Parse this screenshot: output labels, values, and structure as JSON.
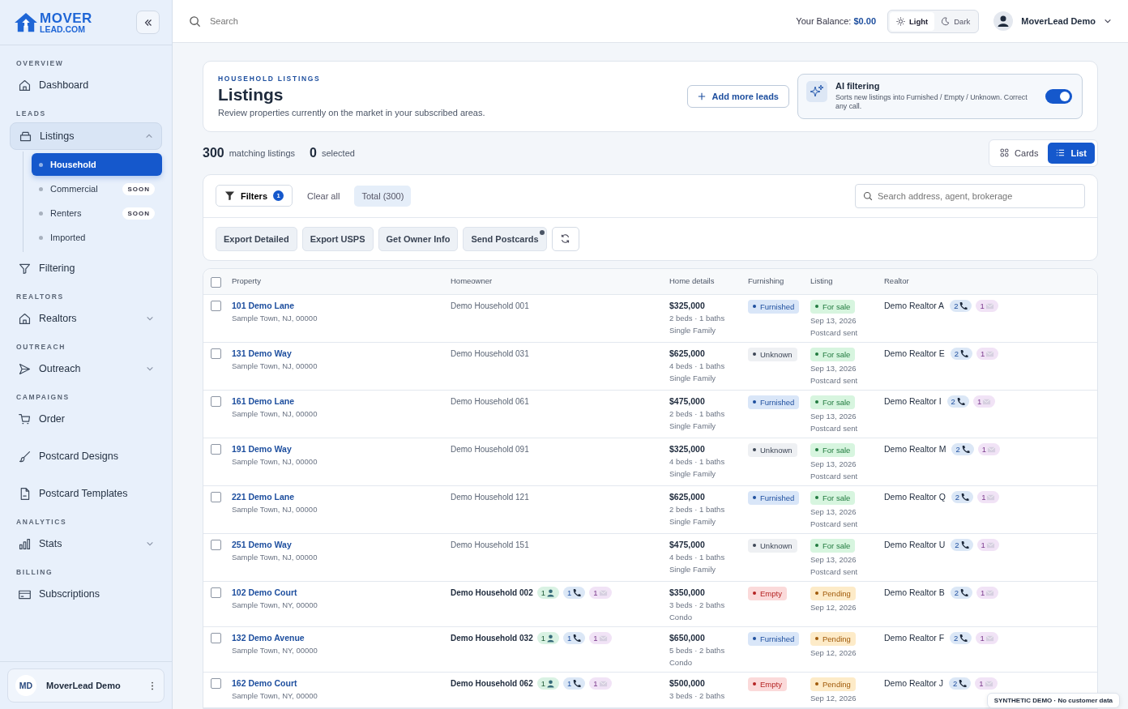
{
  "logo": {
    "line_1": "MOVER",
    "line_2": "LEAD.COM"
  },
  "sidebar": {
    "sections": [
      {
        "title": "OVERVIEW",
        "items": [
          {
            "label": "Dashboard",
            "selected": false
          }
        ]
      },
      {
        "title": "LEADS",
        "items": [
          {
            "label": "Listings",
            "selected": true,
            "expanded": true,
            "children": [
              {
                "label": "Household",
                "selected": true
              },
              {
                "label": "Commercial",
                "selected": false,
                "badge": "SOON"
              },
              {
                "label": "Renters",
                "selected": false,
                "badge": "SOON"
              },
              {
                "label": "Imported",
                "selected": false
              }
            ]
          },
          {
            "label": "Filtering",
            "selected": false
          }
        ]
      },
      {
        "title": "REALTORS",
        "items": [
          {
            "label": "Realtors",
            "selected": false,
            "expanded": false
          }
        ]
      },
      {
        "title": "OUTREACH",
        "items": [
          {
            "label": "Outreach",
            "selected": false,
            "expanded": false
          }
        ]
      },
      {
        "title": "CAMPAIGNS",
        "items": [
          {
            "label": "Order",
            "selected": false
          },
          {
            "label": "Postcard Designs",
            "selected": false
          },
          {
            "label": "Postcard Templates",
            "selected": false
          }
        ]
      },
      {
        "title": "ANALYTICS",
        "items": [
          {
            "label": "Stats",
            "selected": false,
            "expanded": false
          }
        ]
      },
      {
        "title": "BILLING",
        "items": [
          {
            "label": "Subscriptions",
            "selected": false
          }
        ]
      }
    ],
    "user": {
      "initials": "MD",
      "name": "MoverLead Demo"
    }
  },
  "topbar": {
    "search": {
      "placeholder": "Search"
    },
    "balance_label": "Your Balance:",
    "balance": "$0.00",
    "theme": [
      {
        "label": "Light",
        "selected": true
      },
      {
        "label": "Dark",
        "selected": false
      }
    ],
    "user": "MoverLead Demo"
  },
  "header": {
    "eyebrow": "HOUSEHOLD LISTINGS",
    "title": "Listings",
    "subtitle": "Review properties currently on the market in your subscribed areas.",
    "add_button": "Add more leads",
    "ai": {
      "title": "AI filtering",
      "description": "Sorts new listings into Furnished / Empty / Unknown. Correct any call.",
      "on": true
    }
  },
  "summary": {
    "count": "300",
    "count_label": "matching listings",
    "selected": "0",
    "selected_label": "selected",
    "views": [
      {
        "label": "Cards",
        "selected": false
      },
      {
        "label": "List",
        "selected": true
      }
    ]
  },
  "toolbar": {
    "filters": "Filters",
    "filter_count": "1",
    "clear": "Clear all",
    "total": "Total (300)",
    "search": {
      "placeholder": "Search address, agent, brokerage"
    },
    "actions": [
      {
        "label": "Export Detailed",
        "dot": false
      },
      {
        "label": "Export USPS",
        "dot": false
      },
      {
        "label": "Get Owner Info",
        "dot": false
      },
      {
        "label": "Send Postcards",
        "dot": true
      }
    ]
  },
  "table": {
    "columns": [
      "Property",
      "Homeowner",
      "Home details",
      "Furnishing",
      "Listing",
      "Realtor"
    ],
    "all_checked": false,
    "rows": [
      {
        "checked": false,
        "address": "101 Demo Lane",
        "city": "Sample Town, NJ, 00000",
        "homeowner": "Demo Household 001",
        "price": "$325,000",
        "rooms": "2 beds · 1 baths",
        "type": "Single Family",
        "furnishing": {
          "label": "Furnished",
          "kind": "furnished"
        },
        "listing": {
          "label": "For sale",
          "kind": "sale"
        },
        "date": "Sep 13, 2026",
        "note": "Postcard sent",
        "realtor": "Demo Realtor A",
        "phones": "2",
        "mails": "1"
      },
      {
        "checked": false,
        "address": "131 Demo Way",
        "city": "Sample Town, NJ, 00000",
        "homeowner": "Demo Household 031",
        "price": "$625,000",
        "rooms": "4 beds · 1 baths",
        "type": "Single Family",
        "furnishing": {
          "label": "Unknown",
          "kind": "unknown"
        },
        "listing": {
          "label": "For sale",
          "kind": "sale"
        },
        "date": "Sep 13, 2026",
        "note": "Postcard sent",
        "realtor": "Demo Realtor E",
        "phones": "2",
        "mails": "1"
      },
      {
        "checked": false,
        "address": "161 Demo Lane",
        "city": "Sample Town, NJ, 00000",
        "homeowner": "Demo Household 061",
        "price": "$475,000",
        "rooms": "2 beds · 1 baths",
        "type": "Single Family",
        "furnishing": {
          "label": "Furnished",
          "kind": "furnished"
        },
        "listing": {
          "label": "For sale",
          "kind": "sale"
        },
        "date": "Sep 13, 2026",
        "note": "Postcard sent",
        "realtor": "Demo Realtor I",
        "phones": "2",
        "mails": "1"
      },
      {
        "checked": false,
        "address": "191 Demo Way",
        "city": "Sample Town, NJ, 00000",
        "homeowner": "Demo Household 091",
        "price": "$325,000",
        "rooms": "4 beds · 1 baths",
        "type": "Single Family",
        "furnishing": {
          "label": "Unknown",
          "kind": "unknown"
        },
        "listing": {
          "label": "For sale",
          "kind": "sale"
        },
        "date": "Sep 13, 2026",
        "note": "Postcard sent",
        "realtor": "Demo Realtor M",
        "phones": "2",
        "mails": "1"
      },
      {
        "checked": false,
        "address": "221 Demo Lane",
        "city": "Sample Town, NJ, 00000",
        "homeowner": "Demo Household 121",
        "price": "$625,000",
        "rooms": "2 beds · 1 baths",
        "type": "Single Family",
        "furnishing": {
          "label": "Furnished",
          "kind": "furnished"
        },
        "listing": {
          "label": "For sale",
          "kind": "sale"
        },
        "date": "Sep 13, 2026",
        "note": "Postcard sent",
        "realtor": "Demo Realtor Q",
        "phones": "2",
        "mails": "1"
      },
      {
        "checked": false,
        "address": "251 Demo Way",
        "city": "Sample Town, NJ, 00000",
        "homeowner": "Demo Household 151",
        "price": "$475,000",
        "rooms": "4 beds · 1 baths",
        "type": "Single Family",
        "furnishing": {
          "label": "Unknown",
          "kind": "unknown"
        },
        "listing": {
          "label": "For sale",
          "kind": "sale"
        },
        "date": "Sep 13, 2026",
        "note": "Postcard sent",
        "realtor": "Demo Realtor U",
        "phones": "2",
        "mails": "1"
      },
      {
        "checked": false,
        "address": "102 Demo Court",
        "city": "Sample Town, NY, 00000",
        "homeowner": "Demo Household 002",
        "contacts": {
          "people": "1",
          "phones": "1",
          "mails": "1"
        },
        "price": "$350,000",
        "rooms": "3 beds · 2 baths",
        "type": "Condo",
        "furnishing": {
          "label": "Empty",
          "kind": "empty"
        },
        "listing": {
          "label": "Pending",
          "kind": "pending"
        },
        "date": "Sep 12, 2026",
        "realtor": "Demo Realtor B",
        "phones": "2",
        "mails": "1"
      },
      {
        "checked": false,
        "address": "132 Demo Avenue",
        "city": "Sample Town, NY, 00000",
        "homeowner": "Demo Household 032",
        "contacts": {
          "people": "1",
          "phones": "1",
          "mails": "1"
        },
        "price": "$650,000",
        "rooms": "5 beds · 2 baths",
        "type": "Condo",
        "furnishing": {
          "label": "Furnished",
          "kind": "furnished"
        },
        "listing": {
          "label": "Pending",
          "kind": "pending"
        },
        "date": "Sep 12, 2026",
        "realtor": "Demo Realtor F",
        "phones": "2",
        "mails": "1"
      },
      {
        "checked": false,
        "address": "162 Demo Court",
        "city": "Sample Town, NY, 00000",
        "homeowner": "Demo Household 062",
        "contacts": {
          "people": "1",
          "phones": "1",
          "mails": "1"
        },
        "price": "$500,000",
        "rooms": "3 beds · 2 baths",
        "furnishing": {
          "label": "Empty",
          "kind": "empty"
        },
        "listing": {
          "label": "Pending",
          "kind": "pending"
        },
        "date": "Sep 12, 2026",
        "realtor": "Demo Realtor J",
        "phones": "2",
        "mails": "1"
      }
    ]
  },
  "notice": "SYNTHETIC DEMO · No customer data"
}
